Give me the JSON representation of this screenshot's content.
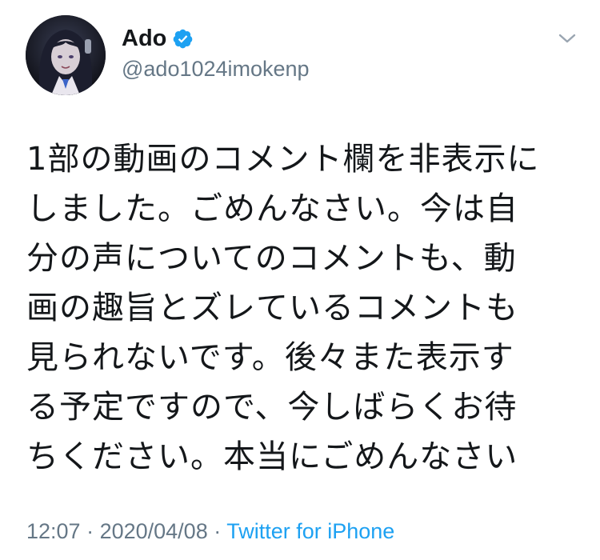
{
  "user": {
    "display_name": "Ado",
    "handle": "@ado1024imokenp",
    "verified": true
  },
  "tweet": {
    "lines": [
      "1部の動画のコメント欄を非表示に",
      "しました。ごめんなさい。今は自",
      "分の声についてのコメントも、動",
      "画の趣旨とズレているコメントも",
      "見られないです。後々また表示す",
      "る予定ですので、今しばらくお待",
      "ちください。本当にごめんなさい"
    ],
    "time": "12:07",
    "separator1": " · ",
    "date": "2020/04/08",
    "separator2": " · ",
    "source": "Twitter for iPhone"
  },
  "icons": {
    "verified": "verified-badge-icon",
    "menu": "chevron-down-icon"
  },
  "colors": {
    "text": "#14171a",
    "secondary": "#657786",
    "link": "#1da1f2",
    "verified": "#1da1f2"
  }
}
